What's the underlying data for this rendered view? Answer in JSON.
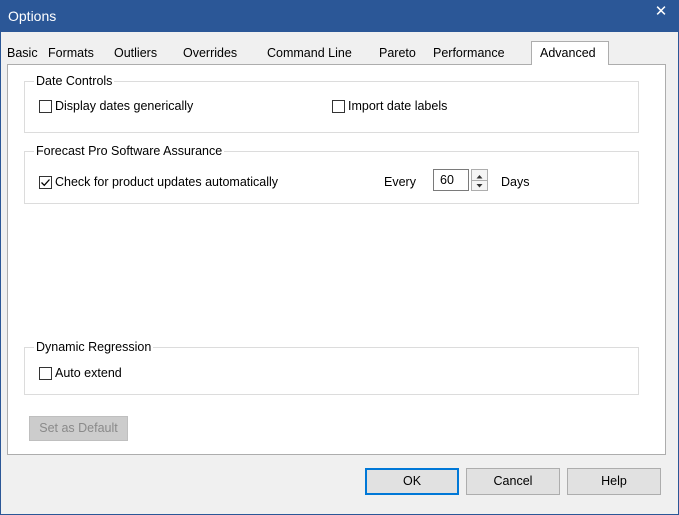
{
  "window": {
    "title": "Options",
    "close_glyph": "✕"
  },
  "tabs": [
    {
      "label": "Basic"
    },
    {
      "label": "Formats"
    },
    {
      "label": "Outliers"
    },
    {
      "label": "Overrides"
    },
    {
      "label": "Command Line"
    },
    {
      "label": "Pareto"
    },
    {
      "label": "Performance"
    },
    {
      "label": "Advanced",
      "active": true
    }
  ],
  "date_controls": {
    "title": "Date Controls",
    "display_dates_generically": {
      "label": "Display dates generically",
      "checked": false
    },
    "import_date_labels": {
      "label": "Import date labels",
      "checked": false
    }
  },
  "software_assurance": {
    "title": "Forecast Pro Software Assurance",
    "check_updates": {
      "label": "Check for product updates automatically",
      "checked": true
    },
    "every_label": "Every",
    "days_value": "60",
    "days_label": "Days"
  },
  "dynamic_regression": {
    "title": "Dynamic Regression",
    "auto_extend": {
      "label": "Auto extend",
      "checked": false
    }
  },
  "buttons": {
    "set_default": "Set as Default",
    "ok": "OK",
    "cancel": "Cancel",
    "help": "Help"
  }
}
